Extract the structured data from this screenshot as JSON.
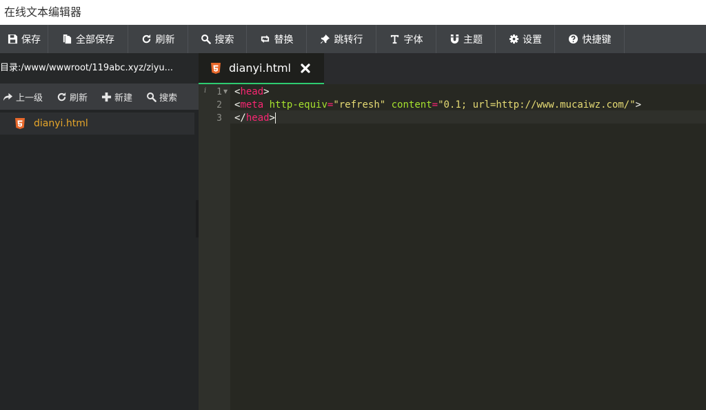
{
  "window": {
    "title": "在线文本编辑器"
  },
  "toolbar": {
    "buttons": [
      {
        "label": "保存",
        "icon": "save-icon"
      },
      {
        "label": "全部保存",
        "icon": "copy-icon"
      },
      {
        "label": "刷新",
        "icon": "refresh-icon"
      },
      {
        "label": "搜索",
        "icon": "search-icon"
      },
      {
        "label": "替换",
        "icon": "retweet-icon"
      },
      {
        "label": "跳转行",
        "icon": "pin-icon"
      },
      {
        "label": "字体",
        "icon": "text-icon"
      },
      {
        "label": "主题",
        "icon": "magnet-icon"
      },
      {
        "label": "设置",
        "icon": "gear-icon"
      },
      {
        "label": "快捷键",
        "icon": "question-icon"
      }
    ]
  },
  "sidebar": {
    "directory_label": "目录:/www/wwwroot/119abc.xyz/ziyu...",
    "actions": [
      {
        "label": "上一级",
        "icon": "share-arrow-icon"
      },
      {
        "label": "刷新",
        "icon": "refresh-icon"
      },
      {
        "label": "新建",
        "icon": "plus-icon"
      },
      {
        "label": "搜索",
        "icon": "search-icon"
      }
    ],
    "files": [
      {
        "name": "dianyi.html",
        "icon": "html5-icon"
      }
    ]
  },
  "editor": {
    "tab": {
      "name": "dianyi.html",
      "icon": "html5-icon"
    },
    "gutter_info": "i",
    "line_numbers": [
      "1",
      "2",
      "3"
    ],
    "code": {
      "l1_open": "<",
      "l1_tag": "head",
      "l1_close": ">",
      "l2_open": "<",
      "l2_tag": "meta",
      "l2_attr1": "http-equiv",
      "l2_eq1": "=",
      "l2_val1": "\"refresh\"",
      "l2_attr2": "content",
      "l2_eq2": "=",
      "l2_val2": "\"0.1; url=http://www.mucaiwz.com/\"",
      "l2_close": ">",
      "l3_open": "</",
      "l3_tag": "head",
      "l3_close": ">"
    }
  },
  "colors": {
    "toolbar_bg": "#3f4245",
    "editor_bg": "#272822",
    "tab_active_underline": "#2ecc71",
    "file_name": "#e6a62a",
    "tag": "#f92672",
    "attr": "#a6e22e",
    "string": "#e6db74"
  }
}
